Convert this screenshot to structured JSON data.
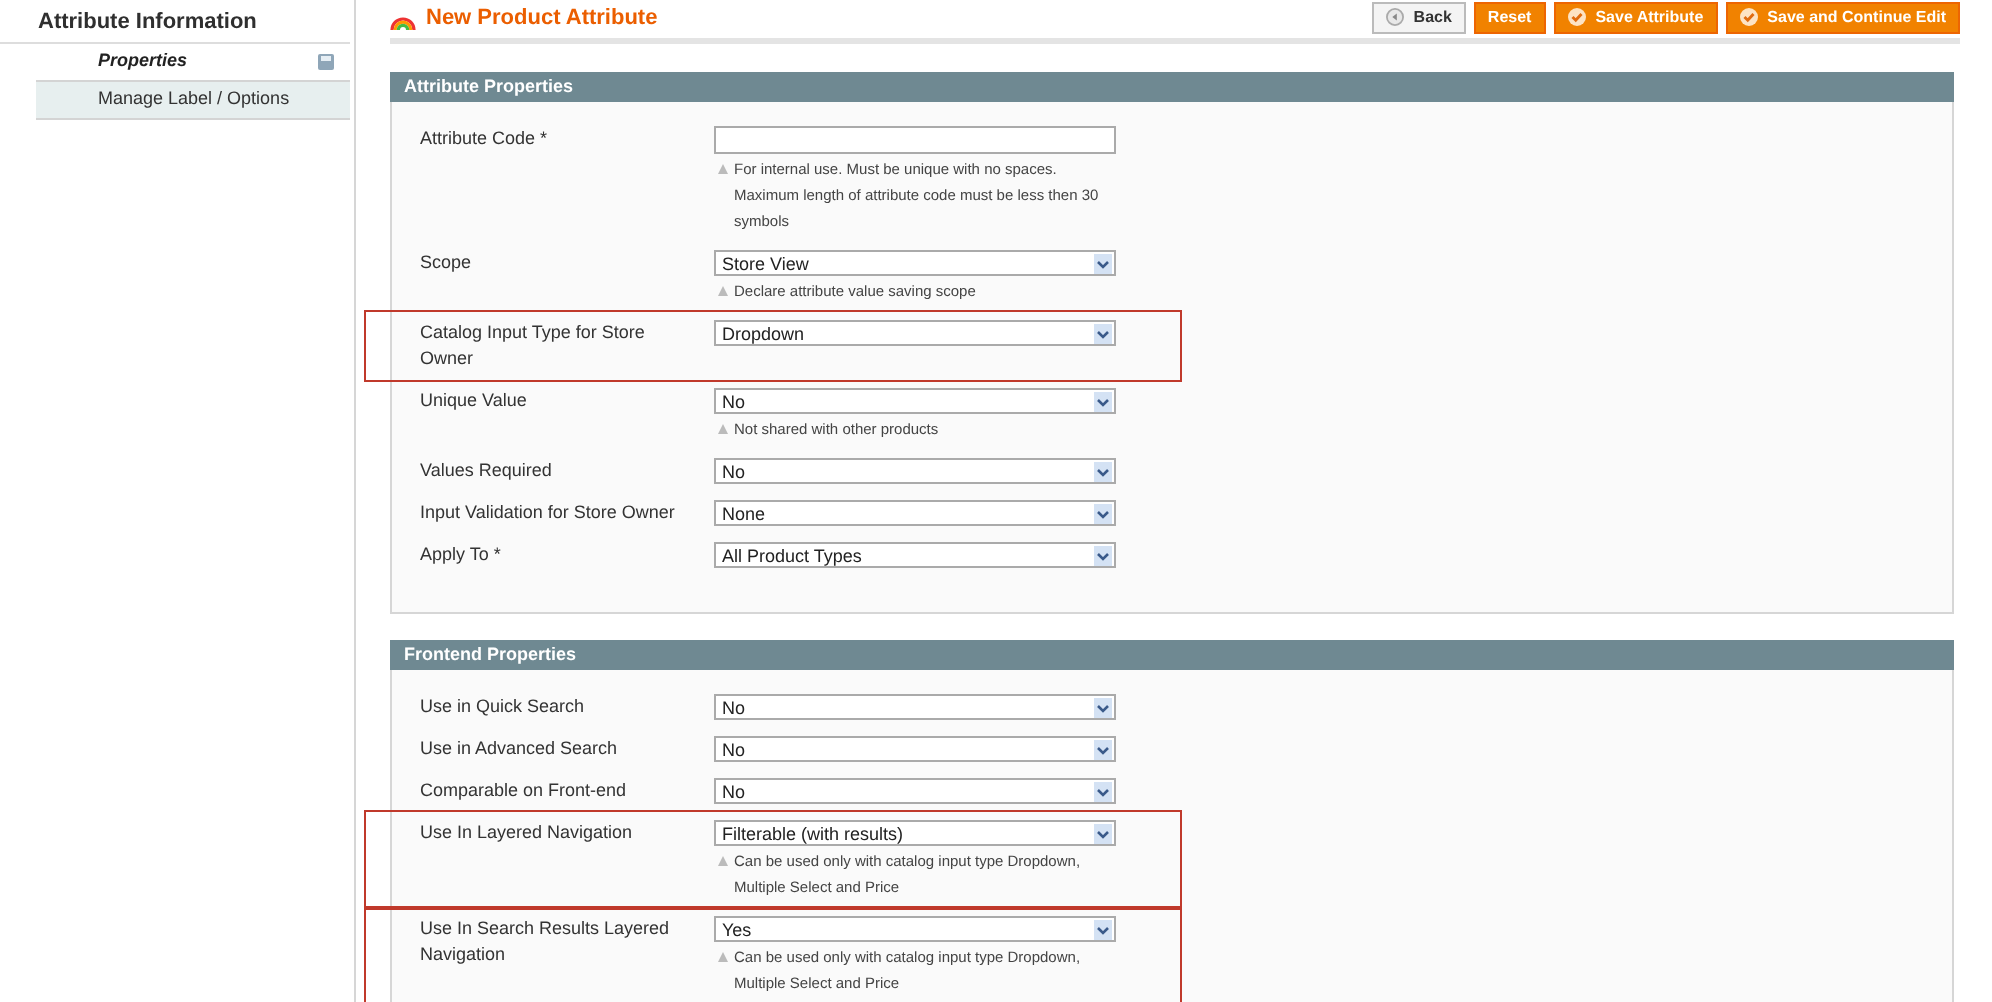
{
  "sidebar": {
    "title": "Attribute Information",
    "tabs": [
      {
        "label": "Properties",
        "selected": true
      },
      {
        "label": "Manage Label / Options",
        "selected": false
      }
    ]
  },
  "header": {
    "title": "New Product Attribute",
    "buttons": [
      {
        "label": "Back",
        "kind": "back"
      },
      {
        "label": "Reset",
        "kind": "plain"
      },
      {
        "label": "Save Attribute",
        "kind": "save"
      },
      {
        "label": "Save and Continue Edit",
        "kind": "save"
      }
    ]
  },
  "sections": [
    {
      "title": "Attribute Properties",
      "fields": [
        {
          "label": "Attribute Code *",
          "kind": "text",
          "note": "For internal use. Must be unique with no spaces. Maximum length of attribute code must be less then 30 symbols",
          "highlighted": false
        },
        {
          "label": "Scope",
          "kind": "select",
          "value": "Store View",
          "note": "Declare attribute value saving scope",
          "highlighted": false
        },
        {
          "label": "Catalog Input Type for Store Owner",
          "kind": "select",
          "value": "Dropdown",
          "highlighted": true
        },
        {
          "label": "Unique Value",
          "kind": "select",
          "value": "No",
          "note": "Not shared with other products",
          "highlighted": false
        },
        {
          "label": "Values Required",
          "kind": "select",
          "value": "No",
          "highlighted": false
        },
        {
          "label": "Input Validation for Store Owner",
          "kind": "select",
          "value": "None",
          "highlighted": false
        },
        {
          "label": "Apply To *",
          "kind": "select",
          "value": "All Product Types",
          "highlighted": false
        }
      ]
    },
    {
      "title": "Frontend Properties",
      "fields": [
        {
          "label": "Use in Quick Search",
          "kind": "select",
          "value": "No",
          "highlighted": false
        },
        {
          "label": "Use in Advanced Search",
          "kind": "select",
          "value": "No",
          "highlighted": false
        },
        {
          "label": "Comparable on Front-end",
          "kind": "select",
          "value": "No",
          "highlighted": false
        },
        {
          "label": "Use In Layered Navigation",
          "kind": "select",
          "value": "Filterable (with results)",
          "note": "Can be used only with catalog input type Dropdown, Multiple Select and Price",
          "highlighted": true
        },
        {
          "label": "Use In Search Results Layered Navigation",
          "kind": "select",
          "value": "Yes",
          "note": "Can be used only with catalog input type Dropdown, Multiple Select and Price",
          "highlighted": true
        }
      ]
    }
  ]
}
